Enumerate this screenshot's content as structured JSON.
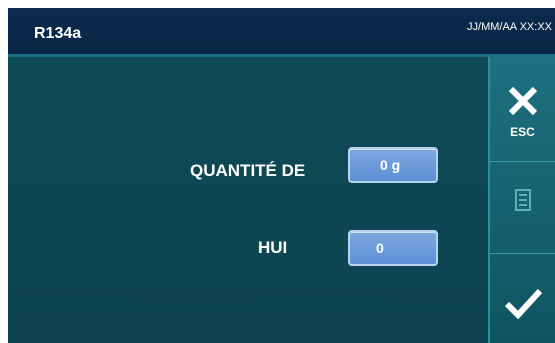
{
  "header": {
    "title": "R134a",
    "datetime": "JJ/MM/AA XX:XX"
  },
  "fields": {
    "quantity": {
      "label": "QUANTITÉ DE",
      "value": "0 g"
    },
    "oil": {
      "label": "HUI",
      "value": "0"
    }
  },
  "sidebar": {
    "esc_label": "ESC",
    "icons": [
      "close-icon",
      "document-icon",
      "check-icon"
    ]
  },
  "colors": {
    "header_bg": "#0b2a4d",
    "main_bg": "#0f4b57",
    "sidebar_bg": "#1e7080",
    "value_box": "#6b9ad9"
  }
}
